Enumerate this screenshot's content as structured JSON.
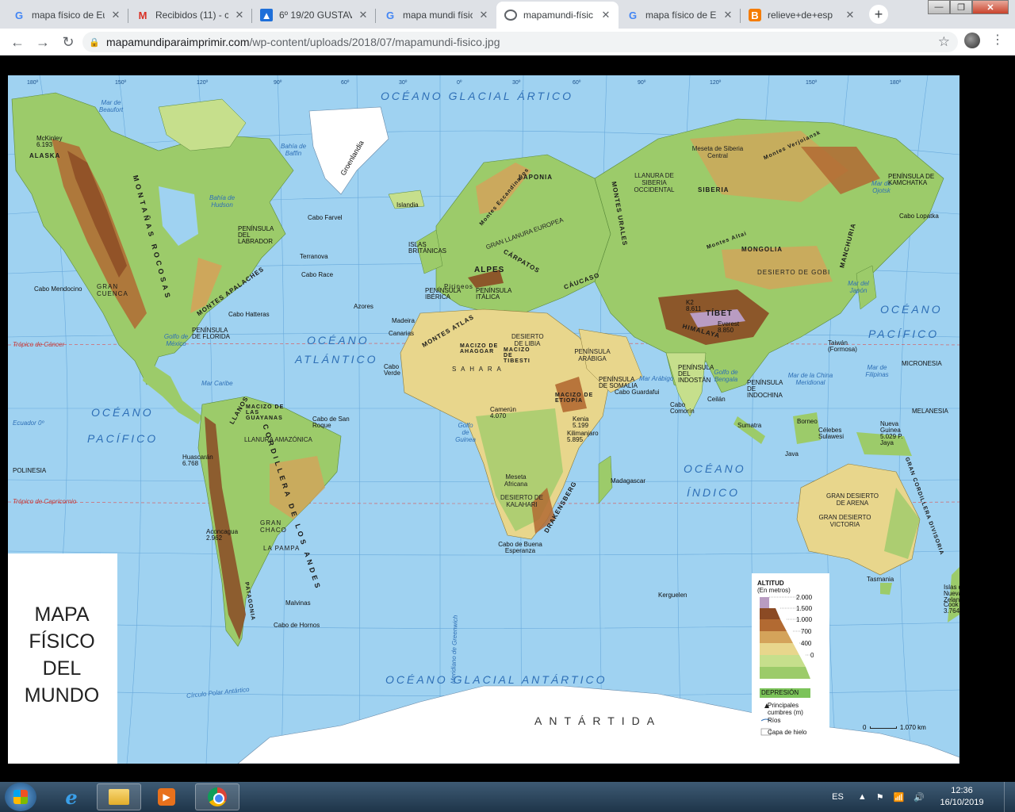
{
  "browser": {
    "tabs": [
      {
        "title": "mapa físico de Eu",
        "icon": "google-icon",
        "active": false
      },
      {
        "title": "Recibidos (11) - c",
        "icon": "gmail-icon",
        "active": false
      },
      {
        "title": "6º 19/20 GUSTAV",
        "icon": "classroom-icon",
        "active": false
      },
      {
        "title": "mapa mundi físic",
        "icon": "google-icon",
        "active": false
      },
      {
        "title": "mapamundi-físic",
        "icon": "globe-icon",
        "active": true
      },
      {
        "title": "mapa físico de Eu",
        "icon": "google-icon",
        "active": false
      },
      {
        "title": "relieve+de+esp",
        "icon": "blogger-icon",
        "active": false
      }
    ],
    "url_host": "mapamundiparaimprimir.com",
    "url_path": "/wp-content/uploads/2018/07/mapamundi-fisico.jpg"
  },
  "map": {
    "title_lines": [
      "MAPA",
      "FÍSICO",
      "DEL",
      "MUNDO"
    ],
    "oceans": {
      "arctic": "OCÉANO GLACIAL ÁRTICO",
      "antarctic": "OCÉANO GLACIAL ANTÁRTICO",
      "pacific_w1": "OCÉANO",
      "pacific_w2": "PACÍFICO",
      "pacific_e1": "OCÉANO",
      "pacific_e2": "PACÍFICO",
      "atlantic1": "OCÉANO",
      "atlantic2": "ATLÁNTICO",
      "indian1": "OCÉANO",
      "indian2": "ÍNDICO",
      "antartida": "ANTÁRTIDA"
    },
    "labels": {
      "groenlandia": "Groenlandia",
      "islandia": "Islandia",
      "alaska": "ALASKA",
      "mckinley": "McKinley 6.193",
      "mar_beaufort": "Mar de Beaufort",
      "bahia_hudson": "Bahía de Hudson",
      "bahia_baffin": "Bahía de Baffin",
      "rocosas": "MONTAÑAS ROCOSAS",
      "apalaches": "MONTES APALACHES",
      "gran_cuenca": "GRAN CUENCA",
      "golfo_mexico": "Golfo de México",
      "peninsula_florida": "PENÍNSULA DE FLORIDA",
      "peninsula_labrador": "PENÍNSULA DEL LABRADOR",
      "cabo_farvel": "Cabo Farvel",
      "terranova": "Terranova",
      "cabo_race": "Cabo Race",
      "cabo_hatteras": "Cabo Hatteras",
      "cabo_mendocino": "Cabo Mendocino",
      "mar_caribe": "Mar Caribe",
      "llanos": "LLANOS",
      "macizo_guayanas": "MACIZO DE LAS GUAYANAS",
      "llanura_amazonica": "LLANURA AMAZÓNICA",
      "cordillera_andes": "CORDILLERA DE LOS ANDES",
      "gran_chaco": "GRAN CHACO",
      "la_pampa": "LA PAMPA",
      "patagonia": "PATAGONIA",
      "cabo_hornos": "Cabo de Hornos",
      "malvinas": "Malvinas",
      "aconcagua": "Aconcagua 2.962",
      "huascaran": "Huascarán 6.768",
      "cabo_san_roque": "Cabo de San Roque",
      "islas_britanicas": "ISLAS BRITÁNICAS",
      "laponia": "LAPONIA",
      "montes_escandinavos": "Montes Escandinavos",
      "llanura_europea": "GRAN LLANURA EUROPEA",
      "alpes": "ALPES",
      "pirineos": "Pirineos",
      "carpatos": "CÁRPATOS",
      "caucaso": "CÁUCASO",
      "montes_urales": "MONTES URALES",
      "peninsula_iberica": "PENÍNSULA IBÉRICA",
      "peninsula_italica": "PENÍNSULA ITÁLICA",
      "montes_atlas": "MONTES ATLAS",
      "sahara": "S A H A R A",
      "macizo_ahaggar": "MACIZO DE AHAGGAR",
      "macizo_tibesti": "MACIZO DE TIBESTI",
      "desierto_libia": "DESIERTO DE LIBIA",
      "macizo_etiopia": "MACIZO DE ETIOPÍA",
      "camerun": "Camerún 4.070",
      "kilimanjaro": "Kilimanjaro 5.895",
      "kenia": "Kenia 5.199",
      "golfo_guinea": "Golfo de Guinea",
      "desierto_kalahari": "DESIERTO DE KALAHARI",
      "drakensberg": "DRAKENSBERG",
      "cabo_buena_esperanza": "Cabo de Buena Esperanza",
      "madagascar": "Madagascar",
      "meseta_africana": "Meseta Africana",
      "peninsula_arabiga": "PENÍNSULA ARÁBIGA",
      "peninsula_somalia": "PENÍNSULA DE SOMALIA",
      "cabo_guardafui": "Cabo Guardafui",
      "siberia": "SIBERIA",
      "llanura_siberia": "LLANURA DE SIBERIA OCCIDENTAL",
      "meseta_siberia": "Meseta de Siberia Central",
      "montes_verjoiansk": "Montes Verjoiansk",
      "tibet": "TÍBET",
      "himalaya": "HIMALAYA",
      "everest": "Everest 8.850",
      "k2": "K2 8.611",
      "desierto_gobi": "DESIERTO DE GOBI",
      "mongolia": "MONGOLIA",
      "manchuria": "MANCHURIA",
      "altai": "Montes Altai",
      "indostan": "PENÍNSULA DEL INDOSTÁN",
      "indochina": "PENÍNSULA DE INDOCHINA",
      "golfo_bengala": "Golfo de Bengala",
      "mar_arabigo": "Mar Arábigo",
      "mar_china": "Mar de la China Meridional",
      "mar_japon": "Mar del Japón",
      "mar_ojotsk": "Mar de Ojotsk",
      "mar_filipinas": "Mar de Filipinas",
      "micronesia": "MICRONESIA",
      "melanesia": "MELANESIA",
      "polinesia": "POLINESIA",
      "nueva_guinea": "Nueva Guinea 5.029 P. Jaya",
      "gran_desierto_arena": "GRAN DESIERTO DE ARENA",
      "gran_desierto_victoria": "GRAN DESIERTO VICTORIA",
      "gran_cordillera": "GRAN CORDILLERA DIVISORIA",
      "tasmania": "Tasmania",
      "nueva_zelanda": "Islas de Nueva Zelanda",
      "cook": "Cook 3.764",
      "kerguelen": "Kerguelen",
      "cabo_comorin": "Cabo Comorín",
      "ceilan": "Ceilán",
      "sumatra": "Sumatra",
      "borneo": "Borneo",
      "java": "Java",
      "celebes": "Célebes Sulawesi",
      "taiwan": "Taiwán (Formosa)",
      "cabo_lopatka": "Cabo Lopatka",
      "peninsula_kamchatka": "PENÍNSULA DE KAMCHATKA",
      "azores": "Azores",
      "canarias": "Canarias",
      "madeira": "Madeira",
      "cabo_verde": "Cabo Verde",
      "tropico_cancer": "Trópico de Cáncer",
      "tropico_capricornio": "Trópico de Capricornio",
      "ecuador": "Ecuador 0º",
      "circulo_polar": "Círculo Polar Antártico",
      "meridiano_greenwich": "Meridiano de Greenwich"
    },
    "coords_top": [
      "180º",
      "150º",
      "120º",
      "90º",
      "60º",
      "30º",
      "0º",
      "30º",
      "60º",
      "90º",
      "120º",
      "150º",
      "180º"
    ],
    "legend": {
      "title": "ALTITUD",
      "subtitle": "(En metros)",
      "levels": [
        "2.000",
        "1.500",
        "1.000",
        "700",
        "400",
        "0"
      ],
      "depression": "DEPRESIÓN",
      "peaks": "Principales cumbres (m)",
      "rivers": "Ríos",
      "ice": "Capa de hielo",
      "colors": [
        "#b99cc2",
        "#8b4a24",
        "#b26a32",
        "#d4a35a",
        "#e8d68c",
        "#c6df8c",
        "#7cc35a"
      ]
    },
    "scale": {
      "zero": "0",
      "value": "1.070 km"
    }
  },
  "taskbar": {
    "lang": "ES",
    "time": "12:36",
    "date": "16/10/2019"
  }
}
